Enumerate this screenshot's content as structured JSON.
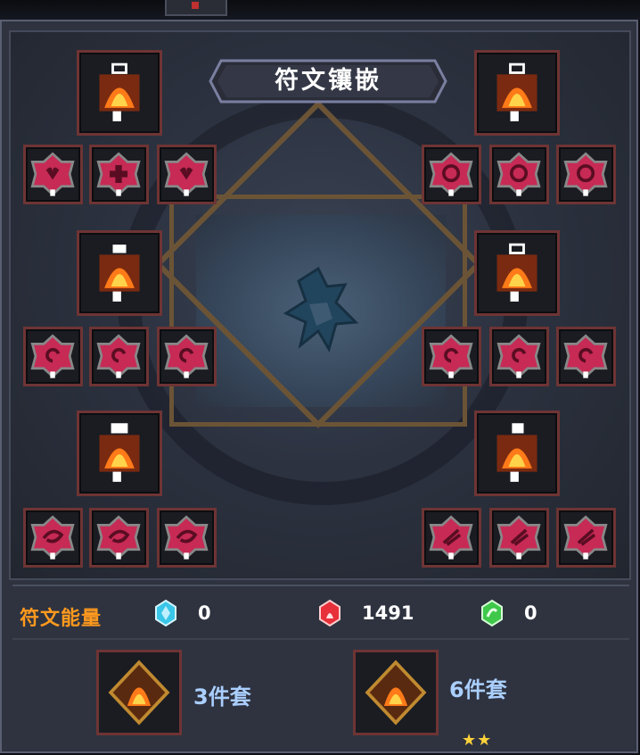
{
  "title": "符文镶嵌",
  "rune_energy": {
    "label": "符文能量",
    "resources": [
      {
        "icon": "blue-gem-icon",
        "color": "#39c6e8",
        "value": "0"
      },
      {
        "icon": "red-flame-gem-icon",
        "color": "#e8303a",
        "value": "1491"
      },
      {
        "icon": "green-gem-icon",
        "color": "#3fc84a",
        "value": "0"
      }
    ]
  },
  "sets": [
    {
      "icon": "fire-set-emblem-icon",
      "label": "3件套",
      "stars": ""
    },
    {
      "icon": "fire-set-emblem-icon",
      "label": "6件套",
      "stars": "★★"
    }
  ],
  "slot_groups": [
    {
      "side": "left",
      "row": 1,
      "main_icon": "flame-lantern-rune-icon",
      "sub_runes": [
        "heart-gem-rune-icon",
        "cross-gem-rune-icon",
        "heart-gem-rune-icon"
      ]
    },
    {
      "side": "right",
      "row": 1,
      "main_icon": "flame-lantern-rune-icon",
      "sub_runes": [
        "ring-gem-rune-icon",
        "ring-gem-rune-icon",
        "ring-gem-rune-icon"
      ]
    },
    {
      "side": "left",
      "row": 2,
      "main_icon": "flame-lantern-rune-icon",
      "sub_runes": [
        "spiral-gem-rune-icon",
        "spiral-gem-rune-icon",
        "spiral-gem-rune-icon"
      ]
    },
    {
      "side": "right",
      "row": 2,
      "main_icon": "flame-lantern-rune-icon",
      "sub_runes": [
        "spiral-gem-rune-icon",
        "spiral-gem-rune-icon",
        "spiral-gem-rune-icon"
      ]
    },
    {
      "side": "left",
      "row": 3,
      "main_icon": "flame-lantern-rune-icon",
      "sub_runes": [
        "swirl-gem-rune-icon",
        "swirl-gem-rune-icon",
        "swirl-gem-rune-icon"
      ]
    },
    {
      "side": "right",
      "row": 3,
      "main_icon": "flame-lantern-rune-icon",
      "sub_runes": [
        "claw-gem-rune-icon",
        "claw-gem-rune-icon",
        "claw-gem-rune-icon"
      ]
    }
  ],
  "colors": {
    "slot_border": "#6e3434",
    "energy_label": "#ff9a1e",
    "set_label": "#aacfff",
    "star": "#ffd23a"
  }
}
